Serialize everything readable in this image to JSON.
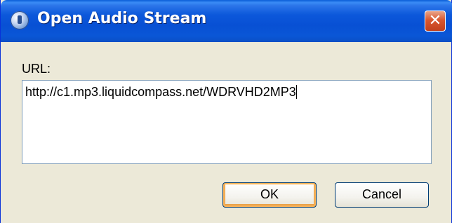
{
  "window": {
    "title": "Open Audio Stream",
    "title_icon": "audio-disc-icon",
    "close_glyph": "✕"
  },
  "form": {
    "url_label": "URL:",
    "url_value": "http://c1.mp3.liquidcompass.net/WDRVHD2MP3"
  },
  "buttons": {
    "ok_label": "OK",
    "cancel_label": "Cancel"
  },
  "colors": {
    "titlebar": "#0a56d6",
    "dialog_bg": "#ece9d8",
    "close_button": "#d9572f",
    "default_button_focus": "#f8b35a"
  }
}
